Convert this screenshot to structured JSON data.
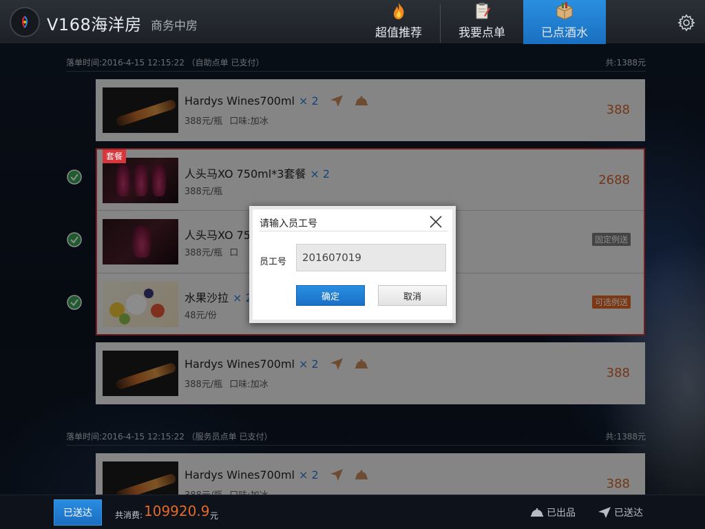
{
  "header": {
    "room_name": "V168海洋房",
    "room_type": "商务中房",
    "tabs": [
      {
        "label": "超值推荐",
        "icon": "fire-icon"
      },
      {
        "label": "我要点单",
        "icon": "order-pad-icon"
      },
      {
        "label": "已点酒水",
        "icon": "drinks-box-icon",
        "active": true
      }
    ]
  },
  "orders": [
    {
      "time": "落单时间:2016-4-15 12:15:22 （自助点单 已支付）",
      "total": "共:1388元",
      "items": [
        {
          "name": "Hardys Wines700ml",
          "qty": "× 2",
          "unit_price": "388元/瓶",
          "taste": "口味:加冰",
          "price": "388"
        },
        {
          "badge": "套餐",
          "name": "人头马XO 750ml*3套餐",
          "qty": "× 2",
          "unit_price": "388元/瓶",
          "price": "2688"
        },
        {
          "name": "人头马XO 75",
          "unit_price": "388元/瓶",
          "taste_partial": "口",
          "tag": "固定例送"
        },
        {
          "name": "水果沙拉",
          "qty": "× 2",
          "unit_price": "48元/份",
          "tag": "可选例送"
        },
        {
          "name": "Hardys Wines700ml",
          "qty": "× 2",
          "unit_price": "388元/瓶",
          "taste": "口味:加冰",
          "price": "388"
        }
      ]
    },
    {
      "time": "落单时间:2016-4-15 12:15:22 （服务员点单 已支付）",
      "total": "共:1388元",
      "items": [
        {
          "name": "Hardys Wines700ml",
          "qty": "× 2",
          "unit_price": "388元/瓶",
          "taste": "口味:加冰",
          "price": "388"
        }
      ]
    }
  ],
  "footer": {
    "delivered_button": "已送达",
    "total_label": "共消费:",
    "total_amount": "109920.9",
    "total_unit": "元",
    "legend_served": "已出品",
    "legend_delivered": "已送达"
  },
  "modal": {
    "title": "请输入员工号",
    "field_label": "员工号",
    "field_value": "201607019",
    "ok_label": "确定",
    "cancel_label": "取消"
  },
  "colors": {
    "accent_blue": "#1a70c6",
    "price_orange": "#d2622a",
    "package_red": "#d8363a",
    "check_green": "#3aa655"
  }
}
